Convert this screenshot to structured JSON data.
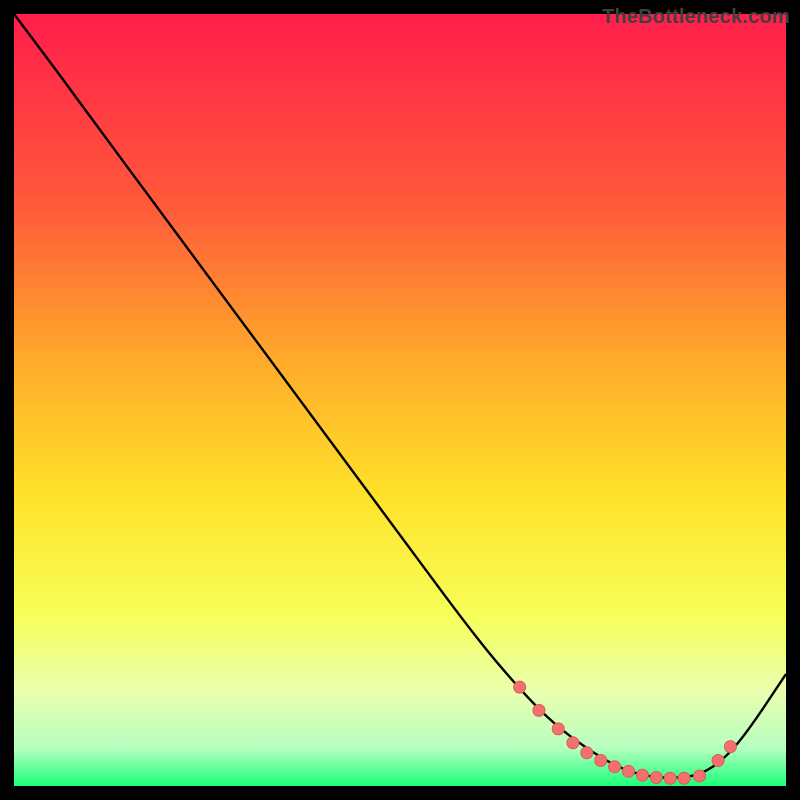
{
  "attribution": "TheBottleneck.com",
  "chart_data": {
    "type": "line",
    "title": "",
    "xlabel": "",
    "ylabel": "",
    "xlim": [
      0,
      100
    ],
    "ylim": [
      0,
      100
    ],
    "gradient_stops": [
      {
        "offset": 0,
        "color": "#ff1e4b"
      },
      {
        "offset": 0.25,
        "color": "#ff5a3a"
      },
      {
        "offset": 0.45,
        "color": "#ffab2a"
      },
      {
        "offset": 0.62,
        "color": "#ffe12a"
      },
      {
        "offset": 0.78,
        "color": "#f7ff5a"
      },
      {
        "offset": 0.88,
        "color": "#e8ffb0"
      },
      {
        "offset": 0.95,
        "color": "#b8ffc0"
      },
      {
        "offset": 1.0,
        "color": "#1cff7a"
      }
    ],
    "series": [
      {
        "name": "curve",
        "color": "#000000",
        "x": [
          0,
          6,
          10,
          20,
          30,
          40,
          50,
          60,
          66,
          70,
          74,
          78,
          82,
          86,
          89,
          92,
          95,
          100
        ],
        "y": [
          100,
          92,
          86.5,
          73,
          59.5,
          46,
          32.5,
          19,
          12,
          8,
          5,
          2.5,
          1.2,
          1,
          1.5,
          3.5,
          7,
          14.5
        ]
      }
    ],
    "markers": {
      "color": "#f2716e",
      "stroke": "#de5a58",
      "radius": 6,
      "x": [
        65.5,
        68,
        70.5,
        72.4,
        74.2,
        76,
        77.8,
        79.6,
        81.4,
        83.2,
        85,
        86.8,
        88.8,
        91.2,
        92.8
      ],
      "y": [
        12.8,
        9.8,
        7.4,
        5.6,
        4.3,
        3.3,
        2.5,
        1.9,
        1.4,
        1.1,
        1.0,
        1.0,
        1.3,
        3.3,
        5.1
      ]
    },
    "plot_inset": {
      "left": 14,
      "right": 14,
      "top": 14,
      "bottom": 14
    }
  }
}
